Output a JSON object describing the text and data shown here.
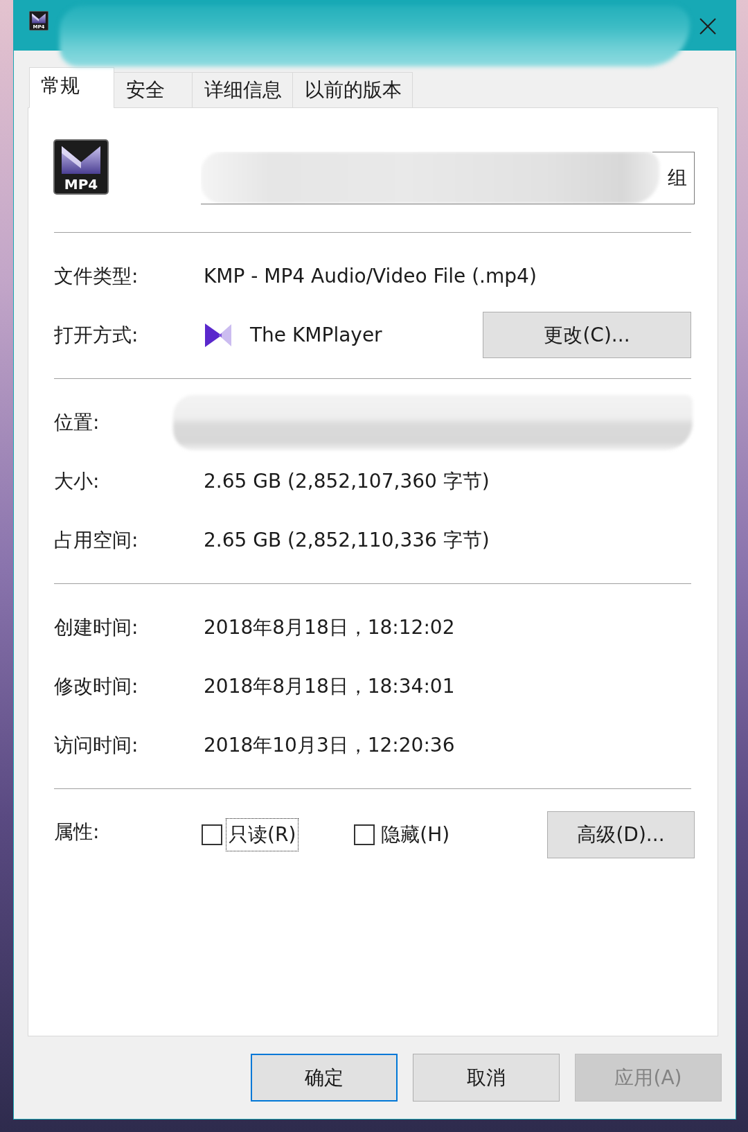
{
  "window": {
    "icon_label": "MP4",
    "title_redacted": true
  },
  "tabs": [
    {
      "label": "常规",
      "selected": true
    },
    {
      "label": "安全",
      "selected": false
    },
    {
      "label": "详细信息",
      "selected": false
    },
    {
      "label": "以前的版本",
      "selected": false
    }
  ],
  "header": {
    "icon_label": "MP4",
    "name_value": "组",
    "name_redacted": true
  },
  "sections": [
    {
      "rows": [
        {
          "kind": "text",
          "label": "文件类型:",
          "value": "KMP - MP4 Audio/Video File (.mp4)"
        },
        {
          "kind": "app",
          "label": "打开方式:",
          "value": "The KMPlayer",
          "button": "更改(C)..."
        }
      ]
    },
    {
      "rows": [
        {
          "kind": "redacted",
          "label": "位置:"
        },
        {
          "kind": "text",
          "label": "大小:",
          "value": "2.65 GB (2,852,107,360 字节)"
        },
        {
          "kind": "text",
          "label": "占用空间:",
          "value": "2.65 GB (2,852,110,336 字节)"
        }
      ]
    },
    {
      "rows": [
        {
          "kind": "text",
          "label": "创建时间:",
          "value": "2018年8月18日，18:12:02"
        },
        {
          "kind": "text",
          "label": "修改时间:",
          "value": "2018年8月18日，18:34:01"
        },
        {
          "kind": "text",
          "label": "访问时间:",
          "value": "2018年10月3日，12:20:36"
        }
      ]
    }
  ],
  "attributes": {
    "label": "属性:",
    "checkboxes": [
      {
        "label": "只读(R)",
        "checked": false,
        "focused": true
      },
      {
        "label": "隐藏(H)",
        "checked": false,
        "focused": false
      }
    ],
    "button": "高级(D)..."
  },
  "buttons": [
    {
      "label": "确定",
      "default": true,
      "disabled": false
    },
    {
      "label": "取消",
      "default": false,
      "disabled": false
    },
    {
      "label": "应用(A)",
      "default": false,
      "disabled": true
    }
  ]
}
